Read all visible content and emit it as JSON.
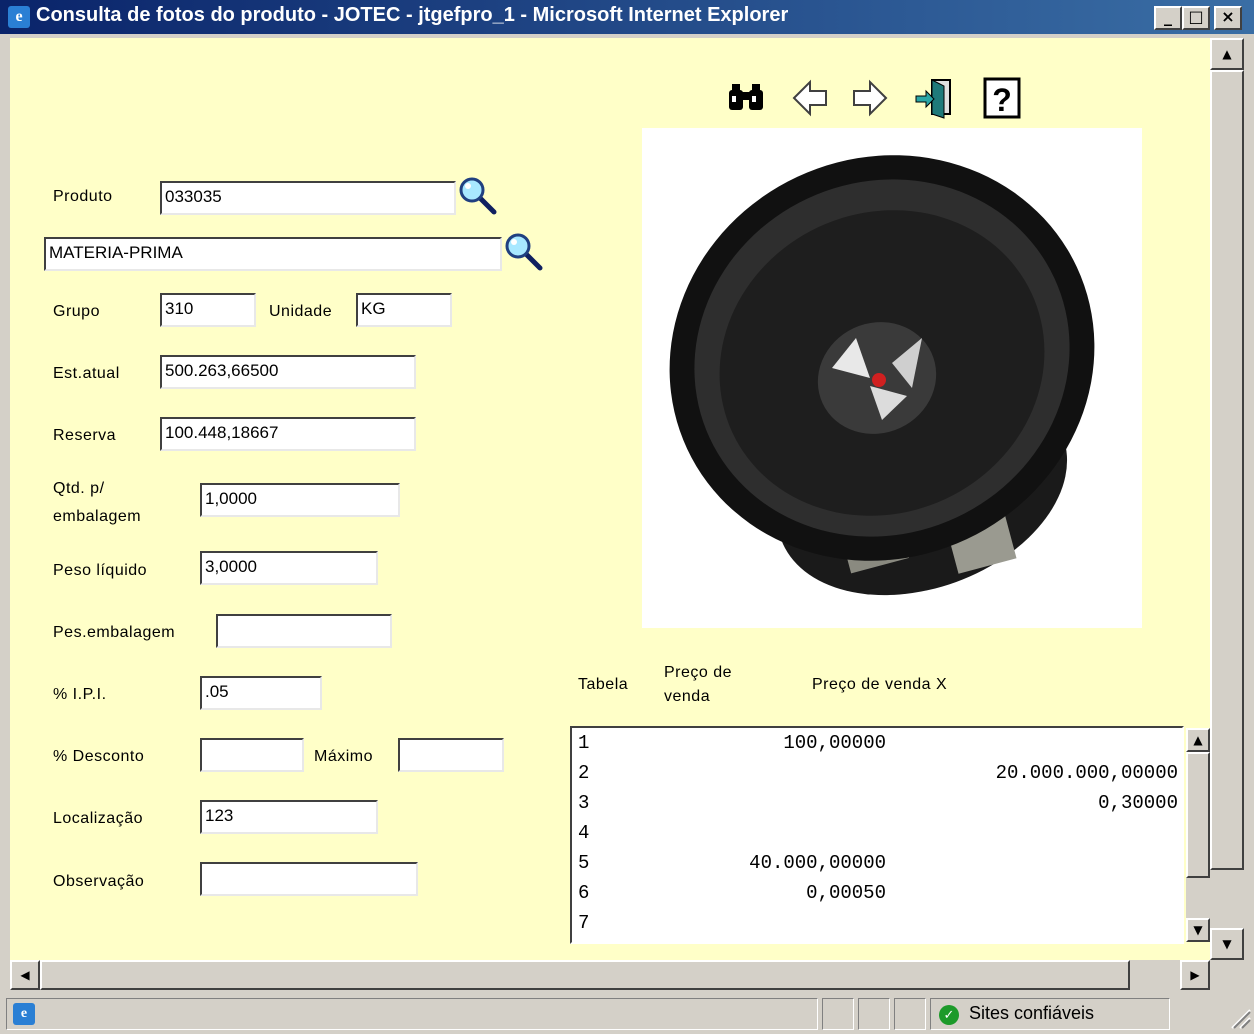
{
  "window": {
    "title": "Consulta de fotos do produto - JOTEC - jtgefpro_1 - Microsoft Internet Explorer",
    "minimize": "_",
    "maximize": "□",
    "close": "×"
  },
  "toolbar": {
    "icons": [
      "binoculars-icon",
      "back-arrow-icon",
      "forward-arrow-icon",
      "exit-door-icon",
      "help-icon"
    ],
    "help_glyph": "?"
  },
  "form": {
    "produto_label": "Produto",
    "produto_value": "033035",
    "descricao_value": "MATERIA-PRIMA",
    "grupo_label": "Grupo",
    "grupo_value": "310",
    "unidade_label": "Unidade",
    "unidade_value": "KG",
    "est_atual_label": "Est.atual",
    "est_atual_value": "500.263,66500",
    "reserva_label": "Reserva",
    "reserva_value": "100.448,18667",
    "qtd_label_1": "Qtd. p/",
    "qtd_label_2": "embalagem",
    "qtd_value": "1,0000",
    "peso_liquido_label": "Peso líquido",
    "peso_liquido_value": "3,0000",
    "pes_embalagem_label": "Pes.embalagem",
    "pes_embalagem_value": "",
    "ipi_label": "% I.P.I.",
    "ipi_value": ".05",
    "desconto_label": "% Desconto",
    "desconto_value": "",
    "maximo_label": "Máximo",
    "maximo_value": "",
    "localizacao_label": "Localização",
    "localizacao_value": "123",
    "observacao_label": "Observação",
    "observacao_value": ""
  },
  "price_table": {
    "col_tabela": "Tabela",
    "col_preco_1": "Preço de",
    "col_preco_2": "venda",
    "col_preco_x": "Preço de venda X",
    "rows": [
      {
        "idx": "1",
        "venda": "100,00000",
        "venda_x": ""
      },
      {
        "idx": "2",
        "venda": "",
        "venda_x": "20.000.000,00000"
      },
      {
        "idx": "3",
        "venda": "",
        "venda_x": "0,30000"
      },
      {
        "idx": "4",
        "venda": "",
        "venda_x": ""
      },
      {
        "idx": "5",
        "venda": "40.000,00000",
        "venda_x": ""
      },
      {
        "idx": "6",
        "venda": "0,00050",
        "venda_x": ""
      },
      {
        "idx": "7",
        "venda": "",
        "venda_x": ""
      }
    ]
  },
  "status": {
    "zone_text": "Sites confiáveis"
  },
  "colors": {
    "content_bg": "#ffffc8",
    "title_bg": "#0a246a",
    "chrome": "#d4d0c8"
  }
}
